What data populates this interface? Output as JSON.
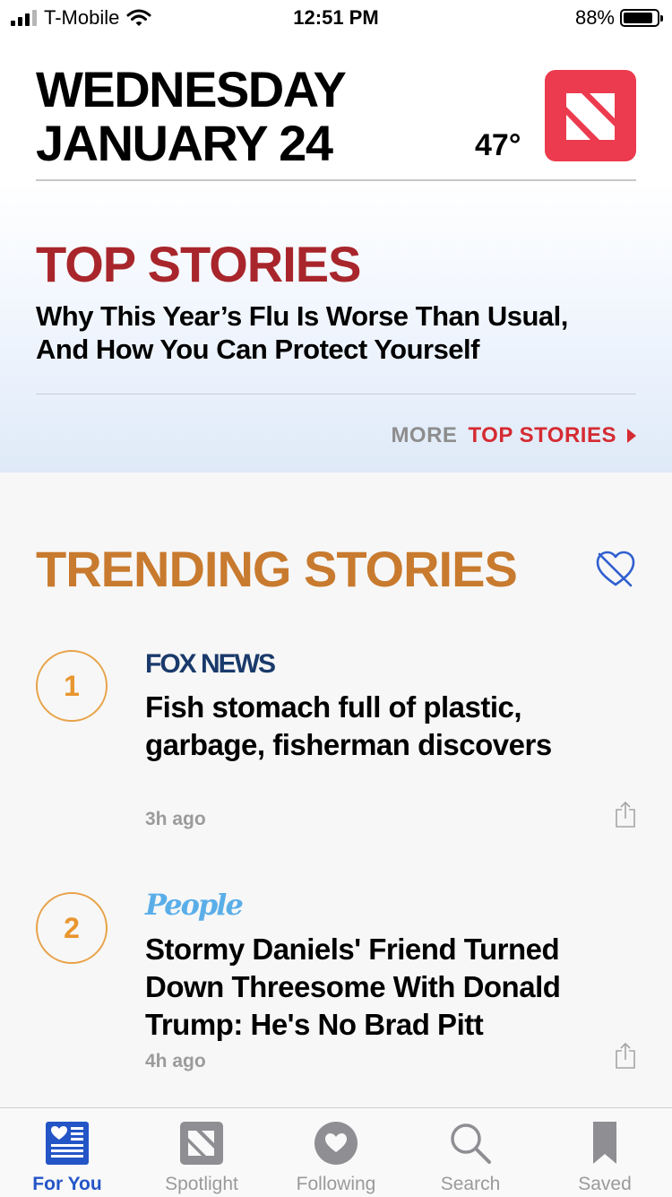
{
  "status": {
    "carrier": "T-Mobile",
    "time": "12:51 PM",
    "battery": "88%",
    "battery_level": 0.88
  },
  "header": {
    "day": "WEDNESDAY",
    "date": "JANUARY 24",
    "temperature": "47°",
    "logo_icon": "apple-news-logo-icon"
  },
  "top_stories": {
    "title": "TOP STORIES",
    "headline_line1": "Why This Year’s Flu Is Worse Than Usual,",
    "headline_line2": "And How You Can Protect Yourself",
    "more_prefix": "MORE",
    "more_label": "TOP STORIES"
  },
  "trending": {
    "title": "TRENDING STORIES",
    "items": [
      {
        "rank": "1",
        "source": "FOX NEWS",
        "headline_line1": "Fish stomach full of plastic,",
        "headline_line2": "garbage, fisherman discovers",
        "time_ago": "3h ago"
      },
      {
        "rank": "2",
        "source": "People",
        "headline_line1": "Stormy Daniels' Friend Turned",
        "headline_line2": "Down Threesome With Donald",
        "headline_line3": "Trump: He's No Brad Pitt",
        "time_ago": "4h ago"
      }
    ]
  },
  "tabs": [
    {
      "label": "For You",
      "icon": "for-you-icon",
      "active": true
    },
    {
      "label": "Spotlight",
      "icon": "spotlight-icon",
      "active": false
    },
    {
      "label": "Following",
      "icon": "following-icon",
      "active": false
    },
    {
      "label": "Search",
      "icon": "search-icon",
      "active": false
    },
    {
      "label": "Saved",
      "icon": "bookmark-icon",
      "active": false
    }
  ],
  "colors": {
    "top_stories_red": "#a8262b",
    "trending_orange": "#c87a2e",
    "active_tab_blue": "#2455c7",
    "logo_red": "#ec3b4e"
  }
}
